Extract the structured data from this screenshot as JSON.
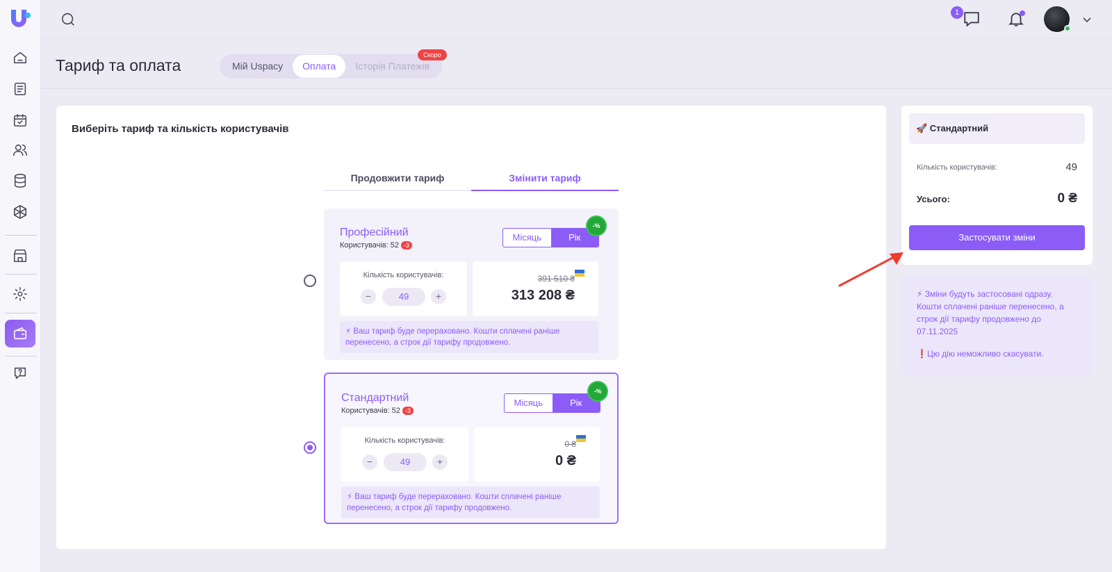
{
  "sidebar": {
    "logo_alt": "Uspacy"
  },
  "topbar": {
    "chat_badge": "1"
  },
  "header": {
    "title": "Тариф та оплата",
    "tabs": [
      {
        "label": "Мій Uspacy"
      },
      {
        "label": "Оплата"
      },
      {
        "label": "Історія Платежів"
      }
    ],
    "soon_badge": "Скоро"
  },
  "main": {
    "heading": "Виберіть тариф та кількість користувачів",
    "segments": [
      "Продовжити тариф",
      "Змінити тариф"
    ],
    "plans": [
      {
        "name": "Професійний",
        "users_label": "Користувачів: 52",
        "users_delta": "-3",
        "period_month": "Місяць",
        "period_year": "Рік",
        "discount": "-%",
        "qty_label": "Кількість користувачів:",
        "qty_minus": "−",
        "qty": "49",
        "qty_plus": "+",
        "price_old": "391 510 ₴",
        "price_new": "313 208 ₴",
        "note": "⚡ Ваш тариф буде перераховано. Кошти сплачені раніше перенесено, а строк дії тарифу продовжено."
      },
      {
        "name": "Стандартний",
        "users_label": "Користувачів: 52",
        "users_delta": "-3",
        "period_month": "Місяць",
        "period_year": "Рік",
        "discount": "-%",
        "qty_label": "Кількість користувачів:",
        "qty_minus": "−",
        "qty": "49",
        "qty_plus": "+",
        "price_old": "0 ₴",
        "price_new": "0 ₴",
        "note": "⚡ Ваш тариф буде перераховано. Кошти сплачені раніше перенесено, а строк дії тарифу продовжено."
      }
    ]
  },
  "summary": {
    "plan": "🚀 Стандартний",
    "users_label": "Кількість користувачів:",
    "users_value": "49",
    "total_label": "Усього:",
    "total_value": "0 ₴",
    "apply_label": "Застосувати зміни"
  },
  "info": {
    "text1": "⚡ Зміни будуть застосовані одразу. Кошти сплачені раніше перенесено, а строк дії тарифу продовжено до 07.11.2025",
    "text2": "❗Цю дію неможливо скасувати."
  },
  "colors": {
    "accent": "#8b5cf6",
    "danger": "#ef4444",
    "success": "#22a839"
  }
}
